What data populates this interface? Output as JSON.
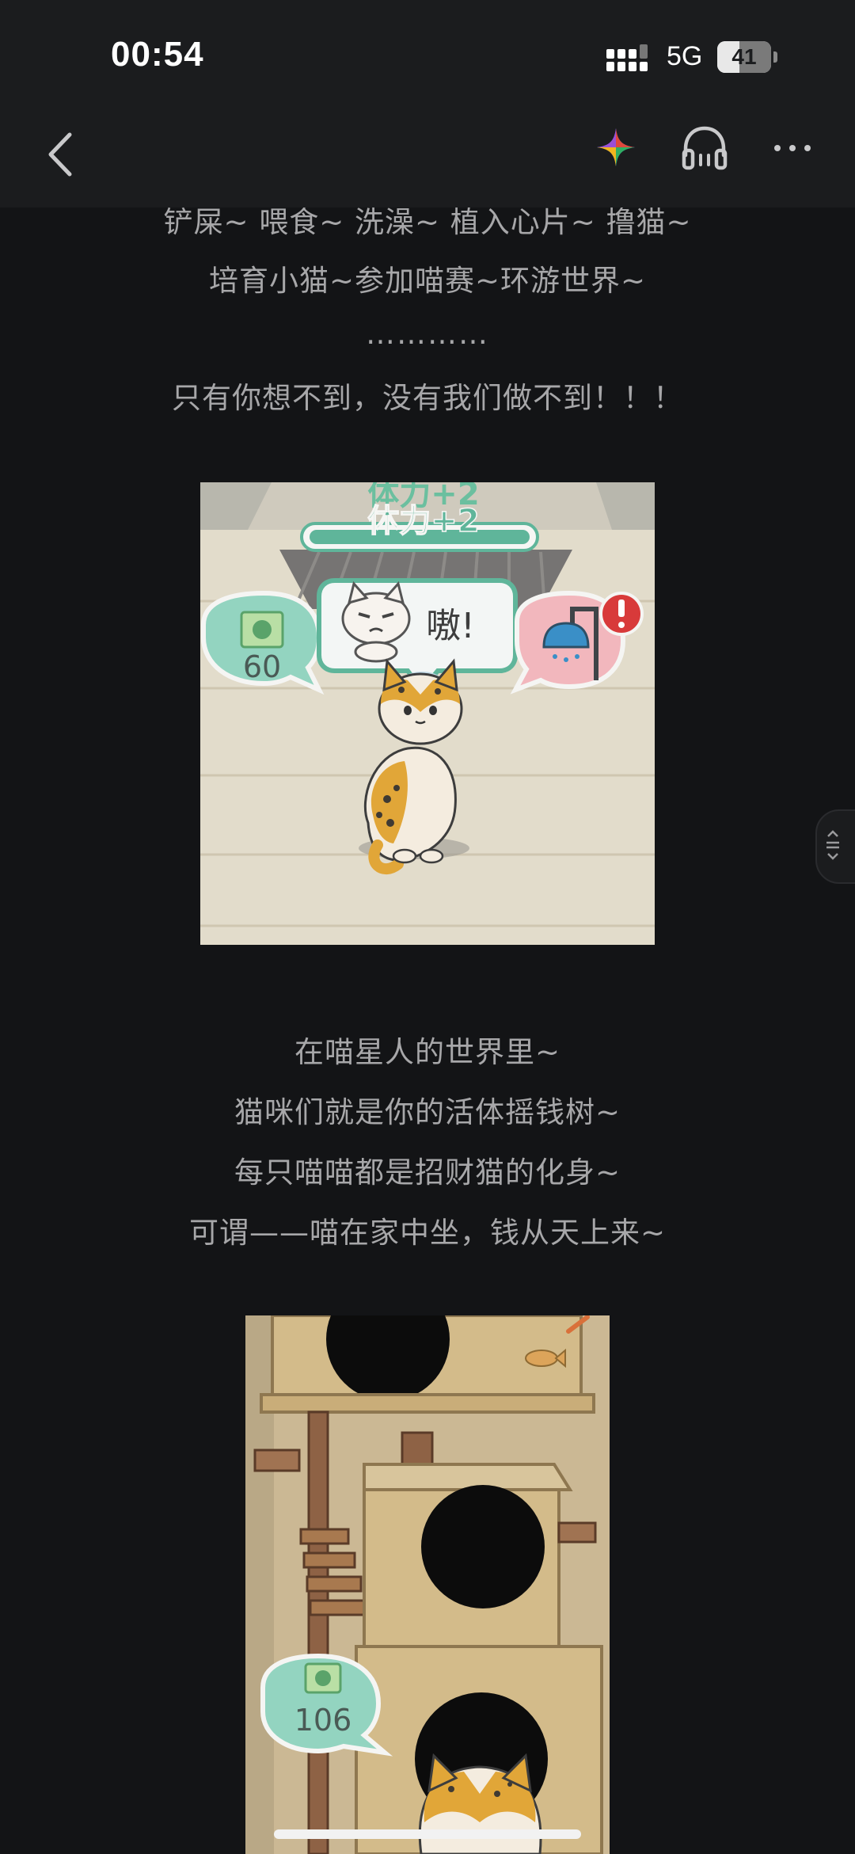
{
  "status_bar": {
    "time": "00:54",
    "network": "5G",
    "battery_level": "41",
    "battery_fraction": 0.41
  },
  "nav": {
    "back_icon": "chevron-left-icon",
    "ai_icon": "ai-sparkle-icon",
    "listen_icon": "headphones-icon",
    "more_icon": "more-dots-icon"
  },
  "article": {
    "paragraphs_top": [
      "铲屎~ 喂食~ 洗澡~ 植入心片~ 撸猫~",
      "培育小猫~参加喵赛~环游世界~",
      "…………",
      "只有你想不到，没有我们做不到！！！"
    ],
    "image1": {
      "stamina_text": "体力+2",
      "speech_text": "嗷!",
      "money_value": "60"
    },
    "paragraphs_mid": [
      "在喵星人的世界里~",
      "猫咪们就是你的活体摇钱树~",
      "每只喵喵都是招财猫的化身~",
      "可谓——喵在家中坐，钱从天上来~"
    ],
    "image2": {
      "money_value": "106"
    }
  },
  "colors": {
    "background": "#131416",
    "bar": "#1b1c1e",
    "text": "#a7a7a9",
    "game_green": "#5fb59a"
  }
}
